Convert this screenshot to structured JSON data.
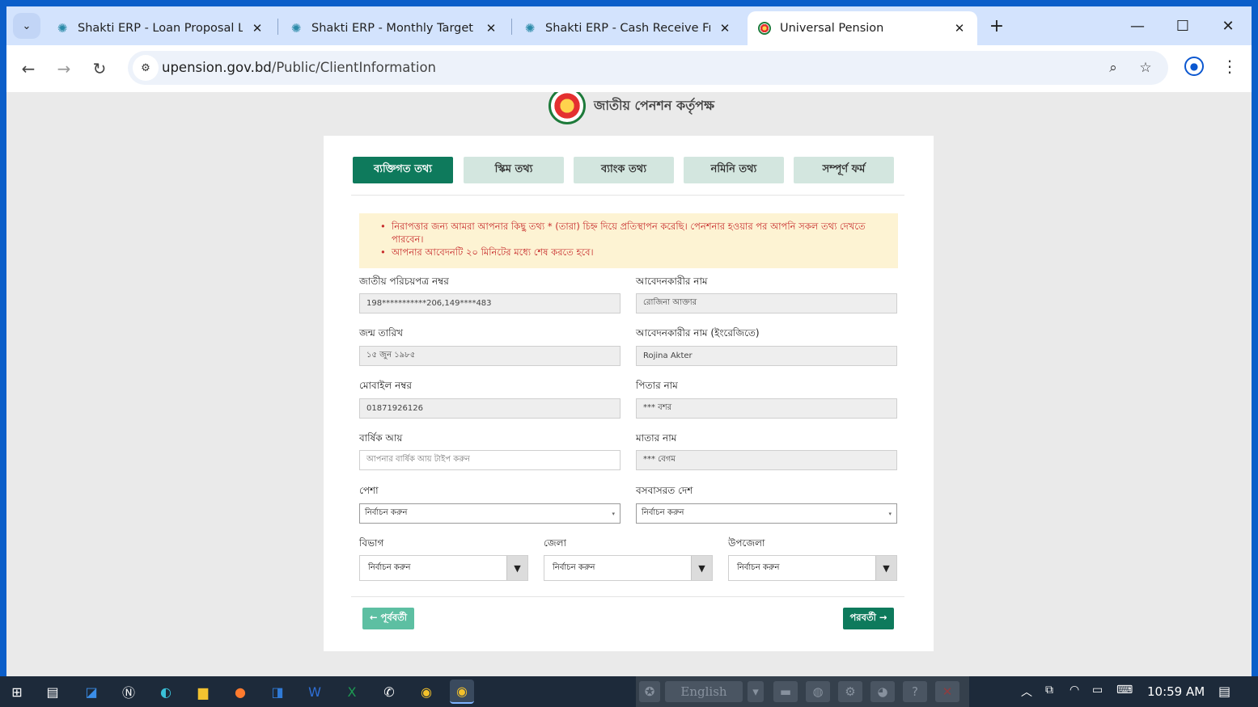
{
  "browser": {
    "tabs": [
      {
        "title": "Shakti ERP - Loan Proposal List",
        "favicon": "spark-icon"
      },
      {
        "title": "Shakti ERP - Monthly Target vs",
        "favicon": "spark-icon"
      },
      {
        "title": "Shakti ERP - Cash Receive From",
        "favicon": "spark-icon"
      },
      {
        "title": "Universal Pension",
        "favicon": "pension-logo-icon"
      }
    ],
    "url_host": "upension.gov.bd",
    "url_path": "/Public/ClientInformation"
  },
  "header": {
    "org_name": "জাতীয় পেনশন কর্তৃপক্ষ"
  },
  "steps": [
    {
      "label": "ব্যক্তিগত তথ্য",
      "active": true
    },
    {
      "label": "স্কিম তথ্য",
      "active": false
    },
    {
      "label": "ব্যাংক তথ্য",
      "active": false
    },
    {
      "label": "নমিনি তথ্য",
      "active": false
    },
    {
      "label": "সম্পূর্ণ ফর্ম",
      "active": false
    }
  ],
  "notice": {
    "line1": "নিরাপত্তার জন্য আমরা আপনার কিছু তথ্য * (তারা) চিহ্ন দিয়ে প্রতিস্থাপন করেছি। পেনশনার হওয়ার পর আপনি সকল তথ্য দেখতে পারবেন।",
    "line2": "আপনার আবেদনটি ২০ মিনিটের মধ্যে শেষ করতে হবে।"
  },
  "form": {
    "nid_label": "জাতীয় পরিচয়পত্র নম্বর",
    "nid_value": "198***********206,149****483",
    "applicant_name_label": "আবেদনকারীর নাম",
    "applicant_name_value": "রোজিনা আক্তার",
    "dob_label": "জন্ম তারিখ",
    "dob_value": "১৫ জুন ১৯৮৫",
    "applicant_name_en_label": "আবেদনকারীর নাম (ইংরেজিতে)",
    "applicant_name_en_value": "Rojina Akter",
    "mobile_label": "মোবাইল নম্বর",
    "mobile_value": "01871926126",
    "father_label": "পিতার নাম",
    "father_value": "*** বশর",
    "income_label": "বার্ষিক আয়",
    "income_placeholder": "আপনার বার্ষিক আয় টাইপ করুন",
    "mother_label": "মাতার নাম",
    "mother_value": "*** বেগম",
    "occupation_label": "পেশা",
    "occupation_value": "নির্বাচন করুন",
    "country_label": "বসবাসরত দেশ",
    "country_value": "নির্বাচন করুন",
    "division_label": "বিভাগ",
    "division_value": "নির্বাচন করুন",
    "district_label": "জেলা",
    "district_value": "নির্বাচন করুন",
    "upazila_label": "উপজেলা",
    "upazila_value": "নির্বাচন করুন"
  },
  "nav": {
    "prev_label": "← পূর্ববর্তী",
    "next_label": "পরবর্তী →"
  },
  "taskbar": {
    "language": "English",
    "time": "10:59 AM"
  },
  "colors": {
    "primary": "#0e7a5c",
    "step_inactive": "#d3e6df",
    "notice_bg": "#fdf3d3",
    "notice_text": "#c72b2b"
  }
}
